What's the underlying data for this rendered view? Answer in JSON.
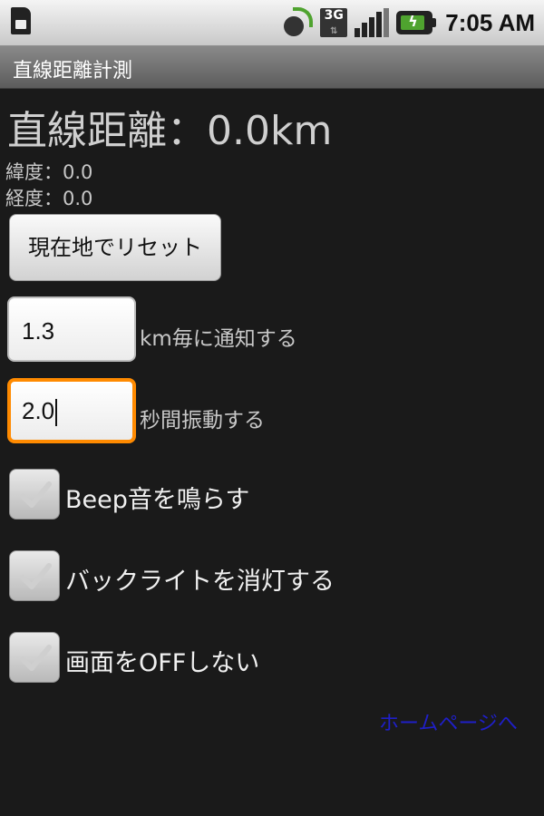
{
  "status_bar": {
    "time": "7:05 AM",
    "network_badge": "3G",
    "icons": [
      "sim-icon",
      "gps-icon",
      "3g-icon",
      "signal-icon",
      "battery-icon"
    ]
  },
  "app": {
    "title": "直線距離計測"
  },
  "distance": {
    "text": "直線距離：0.0km"
  },
  "coords": {
    "latitude": "緯度：0.0",
    "longitude": "経度：0.0"
  },
  "reset_button": {
    "label": "現在地でリセット"
  },
  "notify": {
    "value": "1.3",
    "label": "km毎に通知する"
  },
  "vibrate": {
    "value": "2.0",
    "label": "秒間振動する"
  },
  "checkboxes": [
    {
      "label": "Beep音を鳴らす",
      "checked": false
    },
    {
      "label": "バックライトを消灯する",
      "checked": false
    },
    {
      "label": "画面をOFFしない",
      "checked": false
    }
  ],
  "homepage_link": {
    "label": "ホームページへ"
  },
  "colors": {
    "background": "#1a1a1a",
    "focus_border": "#ff8a00",
    "link": "#1f1fc8"
  }
}
